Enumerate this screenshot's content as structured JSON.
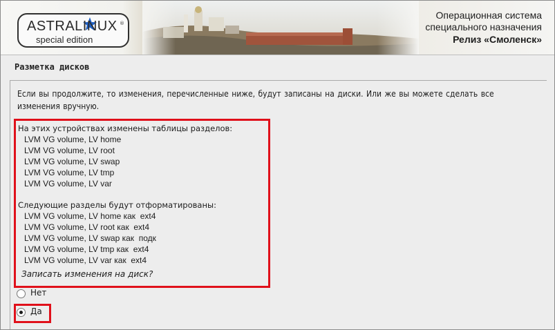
{
  "header": {
    "logo_title": "ASTRALINUX",
    "logo_registered": "®",
    "logo_subtitle": "special edition",
    "os_line1": "Операционная система",
    "os_line2": "специального назначения",
    "os_release": "Релиз «Смоленск»"
  },
  "page": {
    "title": "Разметка дисков",
    "intro": "Если вы продолжите, то изменения, перечисленные ниже, будут записаны на диски. Или же вы можете сделать все изменения вручную."
  },
  "changes": {
    "tables_heading": "На этих устройствах изменены таблицы разделов:",
    "tables_items": [
      "LVM VG volume, LV home",
      "LVM VG volume, LV root",
      "LVM VG volume, LV swap",
      "LVM VG volume, LV tmp",
      "LVM VG volume, LV var"
    ],
    "format_heading": "Следующие разделы будут отформатированы:",
    "format_items": [
      "LVM VG volume, LV home как  ext4",
      "LVM VG volume, LV root как  ext4",
      "LVM VG volume, LV swap как  подк",
      "LVM VG volume, LV tmp как  ext4",
      "LVM VG volume, LV var как  ext4"
    ],
    "question": "Записать изменения на диск?"
  },
  "options": [
    {
      "label": "Нет",
      "selected": false
    },
    {
      "label": "Да",
      "selected": true
    }
  ],
  "colors": {
    "highlight": "#e0101a",
    "background": "#ededed"
  }
}
